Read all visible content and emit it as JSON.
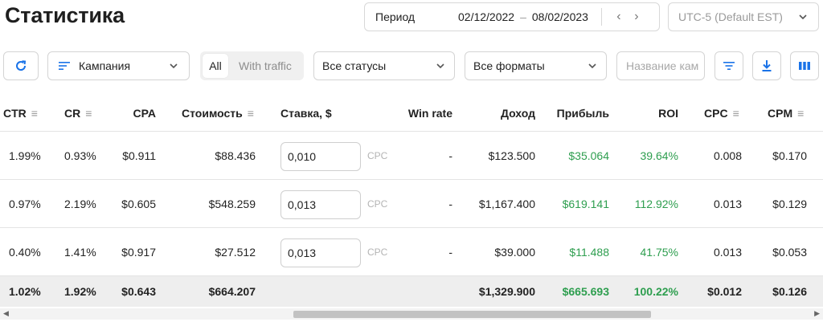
{
  "page": {
    "title": "Статистика"
  },
  "period": {
    "label": "Период",
    "from": "02/12/2022",
    "to": "08/02/2023",
    "dash": "–",
    "prev": "‹",
    "next": "›"
  },
  "timezone": {
    "value": "UTC-5 (Default EST)"
  },
  "toolbar": {
    "refresh_icon": "⟳",
    "campaign_label": "Кампания",
    "seg_all": "All",
    "seg_traffic": "With traffic",
    "status_label": "Все статусы",
    "formats_label": "Все форматы",
    "search_placeholder": "Название кам",
    "icons": [
      "refresh-icon",
      "filter-icon",
      "download-icon",
      "columns-icon"
    ],
    "accent": "#1a73e8"
  },
  "columns": {
    "ctr": "CTR",
    "cr": "CR",
    "cpa": "CPA",
    "cost": "Стоимость",
    "bid": "Ставка, $",
    "winrate": "Win rate",
    "income": "Доход",
    "profit": "Прибыль",
    "roi": "ROI",
    "cpc": "CPC",
    "cpm": "CPM"
  },
  "rows": [
    {
      "ctr": "1.99%",
      "cr": "0.93%",
      "cpa": "$0.911",
      "cost": "$88.436",
      "bid": "0,010",
      "bid_type": "CPC",
      "winrate": "-",
      "income": "$123.500",
      "profit": "$35.064",
      "roi": "39.64%",
      "cpc": "0.008",
      "cpm": "$0.170"
    },
    {
      "ctr": "0.97%",
      "cr": "2.19%",
      "cpa": "$0.605",
      "cost": "$548.259",
      "bid": "0,013",
      "bid_type": "CPC",
      "winrate": "-",
      "income": "$1,167.400",
      "profit": "$619.141",
      "roi": "112.92%",
      "cpc": "0.013",
      "cpm": "$0.129"
    },
    {
      "ctr": "0.40%",
      "cr": "1.41%",
      "cpa": "$0.917",
      "cost": "$27.512",
      "bid": "0,013",
      "bid_type": "CPC",
      "winrate": "-",
      "income": "$39.000",
      "profit": "$11.488",
      "roi": "41.75%",
      "cpc": "0.013",
      "cpm": "$0.053"
    }
  ],
  "totals": {
    "ctr": "1.02%",
    "cr": "1.92%",
    "cpa": "$0.643",
    "cost": "$664.207",
    "income": "$1,329.900",
    "profit": "$665.693",
    "roi": "100.22%",
    "cpc": "$0.012",
    "cpm": "$0.126"
  },
  "colors": {
    "positive": "#2e9e4f",
    "accent": "#1a73e8"
  }
}
